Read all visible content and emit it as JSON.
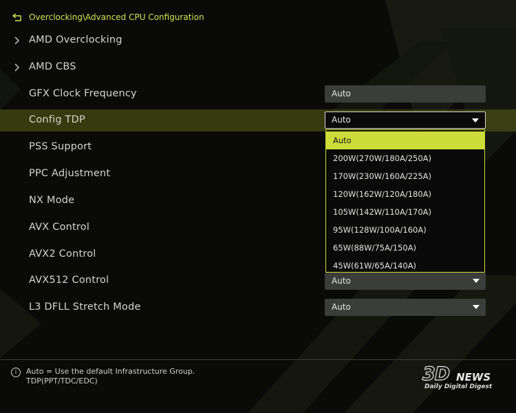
{
  "breadcrumb": "Overclocking\\Advanced CPU Configuration",
  "items": [
    {
      "label": "AMD Overclocking",
      "submenu": true
    },
    {
      "label": "AMD CBS",
      "submenu": true
    },
    {
      "label": "GFX Clock Frequency",
      "value": "Auto"
    },
    {
      "label": "Config TDP",
      "value": "Auto",
      "selected": true
    },
    {
      "label": "PSS Support"
    },
    {
      "label": "PPC Adjustment"
    },
    {
      "label": "NX Mode"
    },
    {
      "label": "AVX Control"
    },
    {
      "label": "AVX2 Control"
    },
    {
      "label": "AVX512 Control",
      "value": "Auto"
    },
    {
      "label": "L3 DFLL Stretch Mode",
      "value": "Auto"
    }
  ],
  "dropdown": {
    "selected": "Auto",
    "options": [
      "Auto",
      "200W(270W/180A/250A)",
      "170W(230W/160A/225A)",
      "120W(162W/120A/180A)",
      "105W(142W/110A/170A)",
      "95W(128W/100A/160A)",
      "65W(88W/75A/150A)",
      "45W(61W/65A/140A)"
    ]
  },
  "help": {
    "icon": "info-icon",
    "line1": "Auto = Use the default Infrastructure Group.",
    "line2": "TDP(PPT/TDC/EDC)"
  },
  "watermark": {
    "big": "3D",
    "news": "NEWS",
    "tagline": "Daily Digital Digest"
  },
  "colors": {
    "accent": "#cddc39",
    "background": "#0a0b08",
    "field": "#3b3d3a",
    "selected_row": "#4a4e12"
  }
}
